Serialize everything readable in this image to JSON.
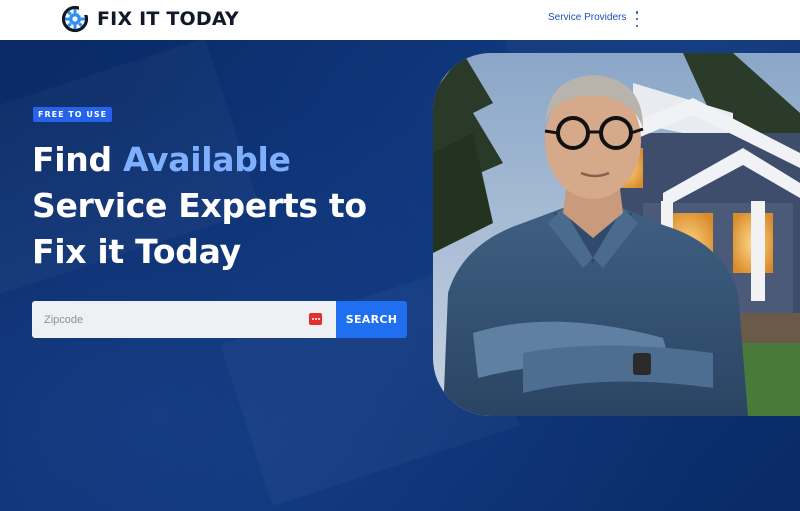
{
  "header": {
    "logo_text": "FIX IT TODAY",
    "nav_link": "Service Providers",
    "menu_icon": "kebab-menu-icon"
  },
  "hero": {
    "badge": "FREE TO USE",
    "headline": {
      "word1": "Find ",
      "accent": "Available",
      "line2": "Service Experts to",
      "line3": "Fix it Today"
    },
    "search": {
      "placeholder": "Zipcode",
      "value": "",
      "button_label": "SEARCH",
      "password_manager_icon": "password-manager-icon"
    }
  },
  "colors": {
    "brand_blue": "#1f6ff0",
    "hero_bg": "#0b2d6b",
    "accent_text": "#7fb0ff"
  }
}
